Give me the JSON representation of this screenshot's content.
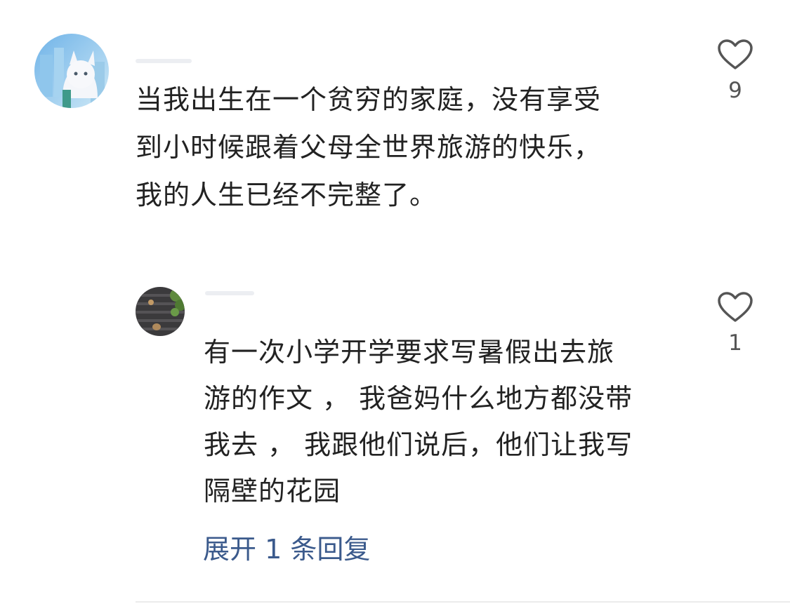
{
  "comment": {
    "text_lines": [
      "当我出生在一个贫穷的家庭，没有享受",
      "到小时候跟着父母全世界旅游的快乐，",
      "我的人生已经不完整了。"
    ],
    "like_count": "9",
    "reply": {
      "text_lines": [
        "有一次小学开学要求写暑假出去旅",
        "游的作文 ， 我爸妈什么地方都没带",
        "我去 ， 我跟他们说后，他们让我写",
        "隔壁的花园"
      ],
      "like_count": "1"
    },
    "expand_replies_label": "展开 1 条回复"
  },
  "colors": {
    "text": "#222222",
    "link": "#3b5a8c",
    "icon": "#555555",
    "divider": "#ececec"
  },
  "icons": {
    "like": "heart-outline-icon"
  }
}
